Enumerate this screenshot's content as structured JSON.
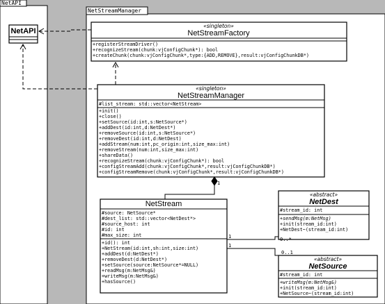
{
  "packages": {
    "netapi": {
      "tab": "NetAPI"
    },
    "manager": {
      "tab": "NetStreamManager"
    }
  },
  "classes": {
    "netapi": {
      "name": "NetAPI"
    },
    "factory": {
      "stereotype": "«singleton»",
      "name": "NetStreamFactory",
      "operations": [
        "+registerStreamDriver()",
        "+recognizeStream(chunk:vjConfigChunk*): bool",
        "+createChunk(chunk:vjConfigChunk*,type:{ADD,REMOVE},result:vjConfigChunkDB*)"
      ]
    },
    "manager": {
      "stereotype": "«singleton»",
      "name": "NetStreamManager",
      "attributes": [
        "#list_stream: std::vector<NetStream>"
      ],
      "operations": [
        "+init()",
        "+close()",
        "+setSource(id:int,s:NetSource*)",
        "+addDest(id:int,d:NetDest*)",
        "+removeSource(id:int,s:NetSource*)",
        "+removeDest(id:int,d:NetDest)",
        "+addStream(num:int,pc_origin:int,size_max:int)",
        "+removeStream(num:int,size_max:int)",
        "+shareData()",
        "+recognizeStream(chunk:vjConfigChunk*): bool",
        "+configStreamAdd(chunk:vjConfigChunk*,result:vjConfigChunkDB*)",
        "+configStreamRemove(chunk:vjConfigChunk*,result:vjConfigChunkDB*)"
      ]
    },
    "netstream": {
      "name": "NetStream",
      "attributes": [
        "#source: NetSource*",
        "#dest_list: std::vector<NetDest*>",
        "#source_host: int",
        "#id: int",
        "#max_size: int"
      ],
      "operations": [
        "+id(): int",
        "+NetStream(id:int,sh:int,size:int)",
        "+addDest(d:NetDest*)",
        "+removeDest(d:NetDest*)",
        "+setSource(source:NetSource*=NULL)",
        "+readMsg(m:NetMsg&)",
        "+writeMsg(m:NetMsg&)",
        "+hasSource()"
      ]
    },
    "netdest": {
      "stereotype": "«abstract»",
      "name": "NetDest",
      "attributes": [
        "#stream_id: int"
      ],
      "operations": [
        {
          "text": "+sendMsg(m:NetMsg)",
          "italic": true
        },
        {
          "text": "+init(stream_id:int)",
          "italic": false
        },
        {
          "text": "+NetDest~(stream_id:int)",
          "italic": false
        }
      ]
    },
    "netsource": {
      "stereotype": "«abstract»",
      "name": "NetSource",
      "attributes": [
        "#stream_id: int"
      ],
      "operations": [
        {
          "text": "+writeMsg(m:NetMsg&)",
          "italic": true
        },
        {
          "text": "+init(stream_id:int)",
          "italic": false
        },
        {
          "text": "+NetSource~(stream_id:int)",
          "italic": false
        }
      ]
    }
  },
  "multiplicities": {
    "manager_composition": "1",
    "netstream_to_dest": "1",
    "dest_end": "0..*",
    "netstream_to_source": "1",
    "source_end": "0..1"
  }
}
